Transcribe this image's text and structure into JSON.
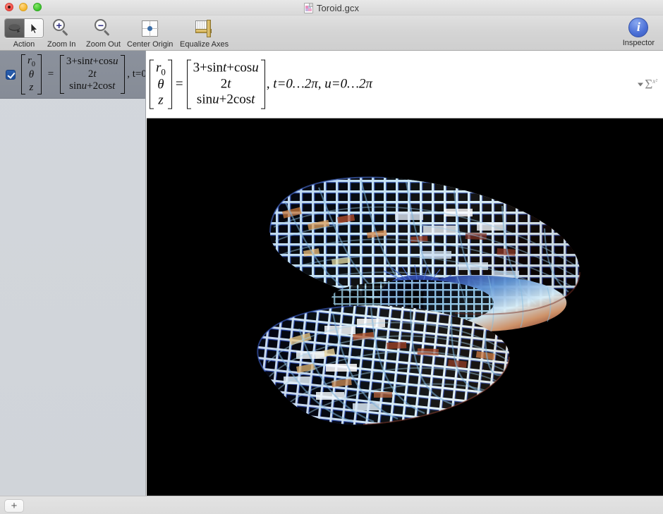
{
  "window": {
    "title": "Toroid.gcx",
    "doc_icon": "document-graph-icon"
  },
  "traffic_lights": {
    "close": "close-button",
    "minimize": "minimize-button",
    "zoom": "zoom-button"
  },
  "toolbar": {
    "items": [
      {
        "label": "Action",
        "icon": "orbit-rotate-icon"
      },
      {
        "label": "Zoom In",
        "icon": "magnifier-plus-icon"
      },
      {
        "label": "Zoom Out",
        "icon": "magnifier-minus-icon"
      },
      {
        "label": "Center Origin",
        "icon": "center-origin-icon"
      },
      {
        "label": "Equalize Axes",
        "icon": "equalize-axes-icon"
      }
    ],
    "action_modes": [
      {
        "name": "rotate",
        "selected": true
      },
      {
        "name": "select",
        "selected": false
      }
    ],
    "inspector": {
      "label": "Inspector",
      "icon": "info-circle-icon",
      "color": "#4a6fd6"
    }
  },
  "sidebar": {
    "rows": [
      {
        "checked": true,
        "lhs": [
          "r0",
          "θ",
          "z"
        ],
        "rhs": [
          "3+sint+cosu",
          "2t",
          "sinu+2cost"
        ],
        "tail": ", t=0"
      }
    ]
  },
  "formula_bar": {
    "lhs": [
      "r0",
      "θ",
      "z"
    ],
    "rhs": [
      "3+sint+cosu",
      "2t",
      "sinu+2cost"
    ],
    "equals": "=",
    "tail": ", t=0…2π, u=0…2π",
    "palette_button": {
      "icon": "sigma-math-palette-icon",
      "glyph": "Σ",
      "exponent": "x²"
    }
  },
  "canvas": {
    "background": "#000000",
    "object": "parametric-toroid-mesh",
    "surface_colors": [
      "#2a3fa8",
      "#4f7fd0",
      "#9fd8e8",
      "#ffffff",
      "#f0b98a",
      "#a6402c"
    ]
  },
  "bottom_bar": {
    "add_label": "+"
  }
}
